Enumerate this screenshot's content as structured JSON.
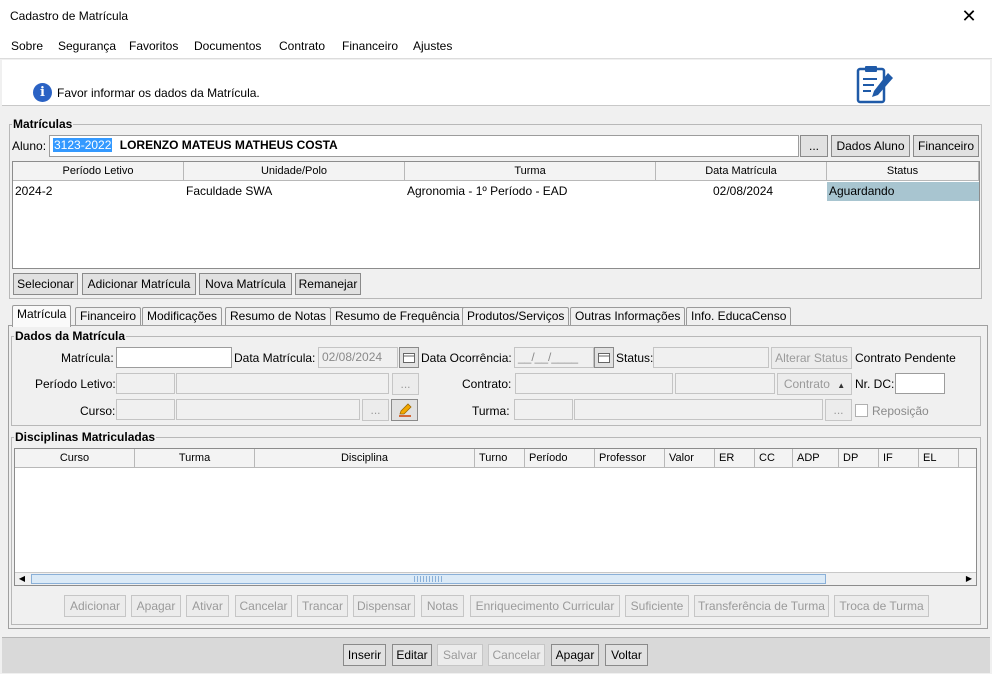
{
  "window": {
    "title": "Cadastro de Matrícula",
    "close_glyph": "✕"
  },
  "menu": [
    "Sobre",
    "Segurança",
    "Favoritos",
    "Documentos",
    "Contrato",
    "Financeiro",
    "Ajustes"
  ],
  "header": {
    "message": "Favor informar os dados da Matrícula.",
    "info_glyph": "i"
  },
  "matriculas": {
    "legend": "Matrículas",
    "aluno_label": "Aluno:",
    "aluno_code": "3123-2022",
    "aluno_name": "LORENZO MATEUS MATHEUS COSTA",
    "browse_label": "...",
    "dados_aluno_label": "Dados Aluno",
    "financeiro_label": "Financeiro",
    "columns": [
      "Período Letivo",
      "Unidade/Polo",
      "Turma",
      "Data Matrícula",
      "Status"
    ],
    "rows": [
      {
        "periodo": "2024-2",
        "unidade": "Faculdade SWA",
        "turma": "Agronomia - 1º Período - EAD",
        "data": "02/08/2024",
        "status": "Aguardando"
      }
    ],
    "actions": [
      "Selecionar",
      "Adicionar Matrícula",
      "Nova Matrícula",
      "Remanejar"
    ]
  },
  "tabs": [
    "Matrícula",
    "Financeiro",
    "Modificações",
    "Resumo de Notas",
    "Resumo de Frequência",
    "Produtos/Serviços",
    "Outras Informações",
    "Info. EducaCenso"
  ],
  "dados": {
    "legend": "Dados da Matrícula",
    "matricula_label": "Matrícula:",
    "data_matricula_label": "Data Matrícula:",
    "data_matricula_value": "02/08/2024",
    "data_ocorrencia_label": "Data Ocorrência:",
    "data_ocorrencia_value": "__/__/____",
    "status_label": "Status:",
    "alterar_status_label": "Alterar Status",
    "contrato_pendente": "Contrato Pendente",
    "periodo_label": "Período Letivo:",
    "contrato_label": "Contrato:",
    "contrato_button": "Contrato",
    "nr_dc_label": "Nr. DC:",
    "curso_label": "Curso:",
    "turma_label": "Turma:",
    "reposicao_label": "Reposição",
    "browse_label": "..."
  },
  "disciplinas": {
    "legend": "Disciplinas Matriculadas",
    "columns": [
      "Curso",
      "Turma",
      "Disciplina",
      "Turno",
      "Período",
      "Professor",
      "Valor",
      "ER",
      "CC",
      "ADP",
      "DP",
      "IF",
      "EL"
    ],
    "actions": [
      "Adicionar",
      "Apagar",
      "Ativar",
      "Cancelar",
      "Trancar",
      "Dispensar",
      "Notas",
      "Enriquecimento Curricular",
      "Suficiente",
      "Transferência de Turma",
      "Troca de Turma"
    ]
  },
  "bottom": [
    "Inserir",
    "Editar",
    "Salvar",
    "Cancelar",
    "Apagar",
    "Voltar"
  ],
  "colors": {
    "selection": "#3399ff",
    "status_cell": "#a8c5d0",
    "info_blue": "#2a62c4"
  }
}
